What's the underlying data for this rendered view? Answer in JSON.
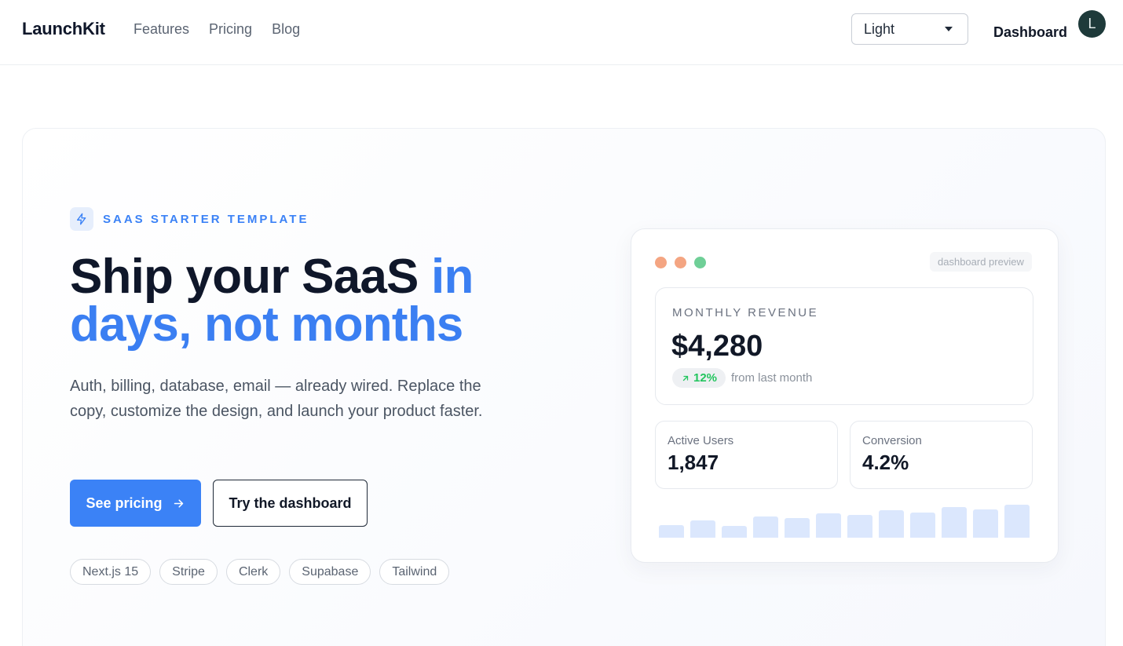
{
  "header": {
    "logo": "LaunchKit",
    "nav": [
      "Features",
      "Pricing",
      "Blog"
    ],
    "theme_select": {
      "value": "Light"
    },
    "dashboard_link": "Dashboard",
    "avatar_initial": "L"
  },
  "hero": {
    "badge": "SAAS STARTER TEMPLATE",
    "headline_part1": "Ship your SaaS ",
    "headline_accent": "in days, not months",
    "subtitle": "Auth, billing, database, email — already wired. Replace the copy, customize the design, and launch your product faster.",
    "primary_button": "See pricing",
    "secondary_button": "Try the dashboard",
    "tags": [
      "Next.js 15",
      "Stripe",
      "Clerk",
      "Supabase",
      "Tailwind"
    ]
  },
  "preview": {
    "window_dot_colors": [
      "#f4a582",
      "#f4a582",
      "#6fcf97"
    ],
    "label": "dashboard preview",
    "revenue": {
      "label": "MONTHLY REVENUE",
      "amount": "$4,280",
      "change": "12%",
      "change_note": "from last month"
    },
    "metrics": [
      {
        "label": "Active Users",
        "value": "1,847"
      },
      {
        "label": "Conversion",
        "value": "4.2%"
      }
    ],
    "bars": [
      0.38,
      0.52,
      0.34,
      0.63,
      0.57,
      0.72,
      0.67,
      0.81,
      0.74,
      0.91,
      0.84,
      0.98
    ]
  },
  "colors": {
    "accent": "#3b82f6",
    "success": "#22c55e",
    "avatar_bg": "#1e3a3a"
  }
}
